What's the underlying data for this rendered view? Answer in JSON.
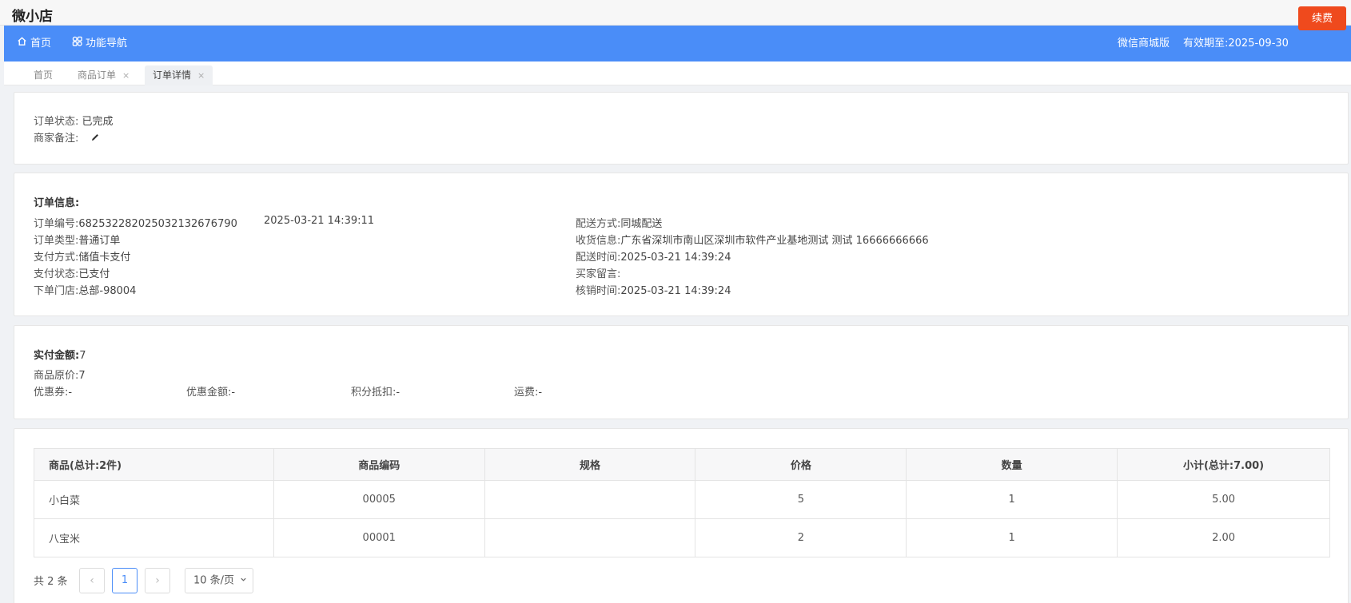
{
  "app": {
    "title": "微小店"
  },
  "nav": {
    "home": "首页",
    "function_nav": "功能导航",
    "edition": "微信商城版",
    "expiry": "有效期至:2025-09-30",
    "renew": "续费"
  },
  "tabs": [
    {
      "label": "首页"
    },
    {
      "label": "商品订单",
      "close": "×"
    },
    {
      "label": "订单详情",
      "close": "×"
    }
  ],
  "status": {
    "status_label": "订单状态:",
    "status_value": "已完成",
    "remark_label": "商家备注:"
  },
  "order_info": {
    "heading": "订单信息:",
    "order_no_label": "订单编号:",
    "order_no": "68253228202503213267679​0",
    "order_time": "2025-03-21 14:39:11",
    "type_label": "订单类型:",
    "type": "普通订单",
    "pay_method_label": "支付方式:",
    "pay_method": "储值卡支付",
    "pay_status_label": "支付状态:",
    "pay_status": "已支付",
    "store_label": "下单门店:",
    "store": "总部-98004",
    "delivery_label": "配送方式:",
    "delivery": "同城配送",
    "address_label": "收货信息:",
    "address": "广东省深圳市南山区深圳市软件产业基地测试 测试 16666666666",
    "delivery_time_label": "配送时间:",
    "delivery_time": "2025-03-21 14:39:24",
    "buyer_msg_label": "买家留言:",
    "buyer_msg": "",
    "verify_time_label": "核销时间:",
    "verify_time": "2025-03-21 14:39:24"
  },
  "amount": {
    "paid_label": "实付金额:",
    "paid": "7",
    "original_label": "商品原价:",
    "original": "7",
    "coupon_label": "优惠券:",
    "coupon": "-",
    "discount_label": "优惠金额:",
    "discount": "-",
    "points_label": "积分抵扣:",
    "points": "-",
    "freight_label": "运费:",
    "freight": "-"
  },
  "goods_table": {
    "headers": [
      "商品(总计:2件)",
      "商品编码",
      "规格",
      "价格",
      "数量",
      "小计(总计:7.00)"
    ],
    "rows": [
      [
        "小白菜",
        "00005",
        "",
        "5",
        "1",
        "5.00"
      ],
      [
        "八宝米",
        "00001",
        "",
        "2",
        "1",
        "2.00"
      ]
    ]
  },
  "pager": {
    "total": "共 2 条",
    "prev": "‹",
    "page": "1",
    "next": "›",
    "page_size": "10 条/页"
  },
  "colors": {
    "nav_bg": "#4a8df8",
    "renew_bg": "#ef4a1d"
  },
  "icons": [
    "home-icon",
    "function-nav-icon",
    "edit-icon",
    "chevron-down-icon"
  ]
}
